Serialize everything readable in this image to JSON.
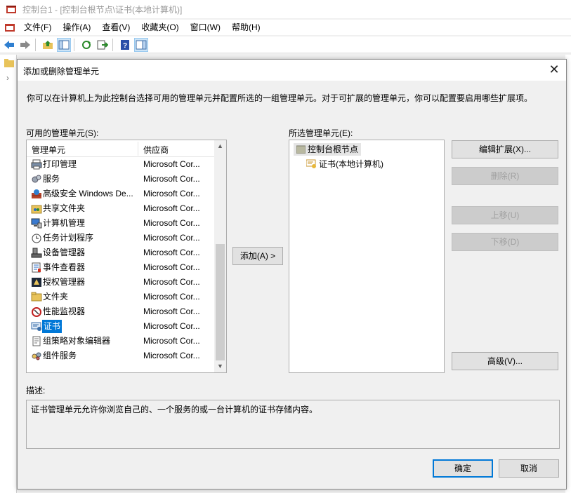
{
  "window": {
    "title": "控制台1 - [控制台根节点\\证书(本地计算机)]",
    "menu": [
      "文件(F)",
      "操作(A)",
      "查看(V)",
      "收藏夹(O)",
      "窗口(W)",
      "帮助(H)"
    ]
  },
  "dialog": {
    "title": "添加或删除管理单元",
    "description": "你可以在计算机上为此控制台选择可用的管理单元并配置所选的一组管理单元。对于可扩展的管理单元，你可以配置要启用哪些扩展项。",
    "available_label": "可用的管理单元(S):",
    "selected_label": "所选管理单元(E):",
    "columns": [
      "管理单元",
      "供应商"
    ],
    "snapins": [
      {
        "name": "打印管理",
        "vendor": "Microsoft Cor...",
        "icon": "printer-icon"
      },
      {
        "name": "服务",
        "vendor": "Microsoft Cor...",
        "icon": "gears-icon"
      },
      {
        "name": "高级安全 Windows De...",
        "vendor": "Microsoft Cor...",
        "icon": "firewall-icon"
      },
      {
        "name": "共享文件夹",
        "vendor": "Microsoft Cor...",
        "icon": "shared-folder-icon"
      },
      {
        "name": "计算机管理",
        "vendor": "Microsoft Cor...",
        "icon": "computer-management-icon"
      },
      {
        "name": "任务计划程序",
        "vendor": "Microsoft Cor...",
        "icon": "clock-icon"
      },
      {
        "name": "设备管理器",
        "vendor": "Microsoft Cor...",
        "icon": "device-manager-icon"
      },
      {
        "name": "事件查看器",
        "vendor": "Microsoft Cor...",
        "icon": "event-viewer-icon"
      },
      {
        "name": "授权管理器",
        "vendor": "Microsoft Cor...",
        "icon": "authorization-icon"
      },
      {
        "name": "文件夹",
        "vendor": "Microsoft Cor...",
        "icon": "folder-icon"
      },
      {
        "name": "性能监视器",
        "vendor": "Microsoft Cor...",
        "icon": "performance-icon"
      },
      {
        "name": "证书",
        "vendor": "Microsoft Cor...",
        "icon": "certificate-icon",
        "selected": true
      },
      {
        "name": "组策略对象编辑器",
        "vendor": "Microsoft Cor...",
        "icon": "policy-icon"
      },
      {
        "name": "组件服务",
        "vendor": "Microsoft Cor...",
        "icon": "component-services-icon"
      }
    ],
    "add_button": "添加(A) >",
    "selected_tree": {
      "root": "控制台根节点",
      "children": [
        "证书(本地计算机)"
      ]
    },
    "buttons": {
      "edit_extensions": "编辑扩展(X)...",
      "remove": "删除(R)",
      "move_up": "上移(U)",
      "move_down": "下移(D)",
      "advanced": "高级(V)...",
      "ok": "确定",
      "cancel": "取消"
    },
    "desc_label": "描述:",
    "desc_text": "证书管理单元允许你浏览自己的、一个服务的或一台计算机的证书存储内容。"
  }
}
